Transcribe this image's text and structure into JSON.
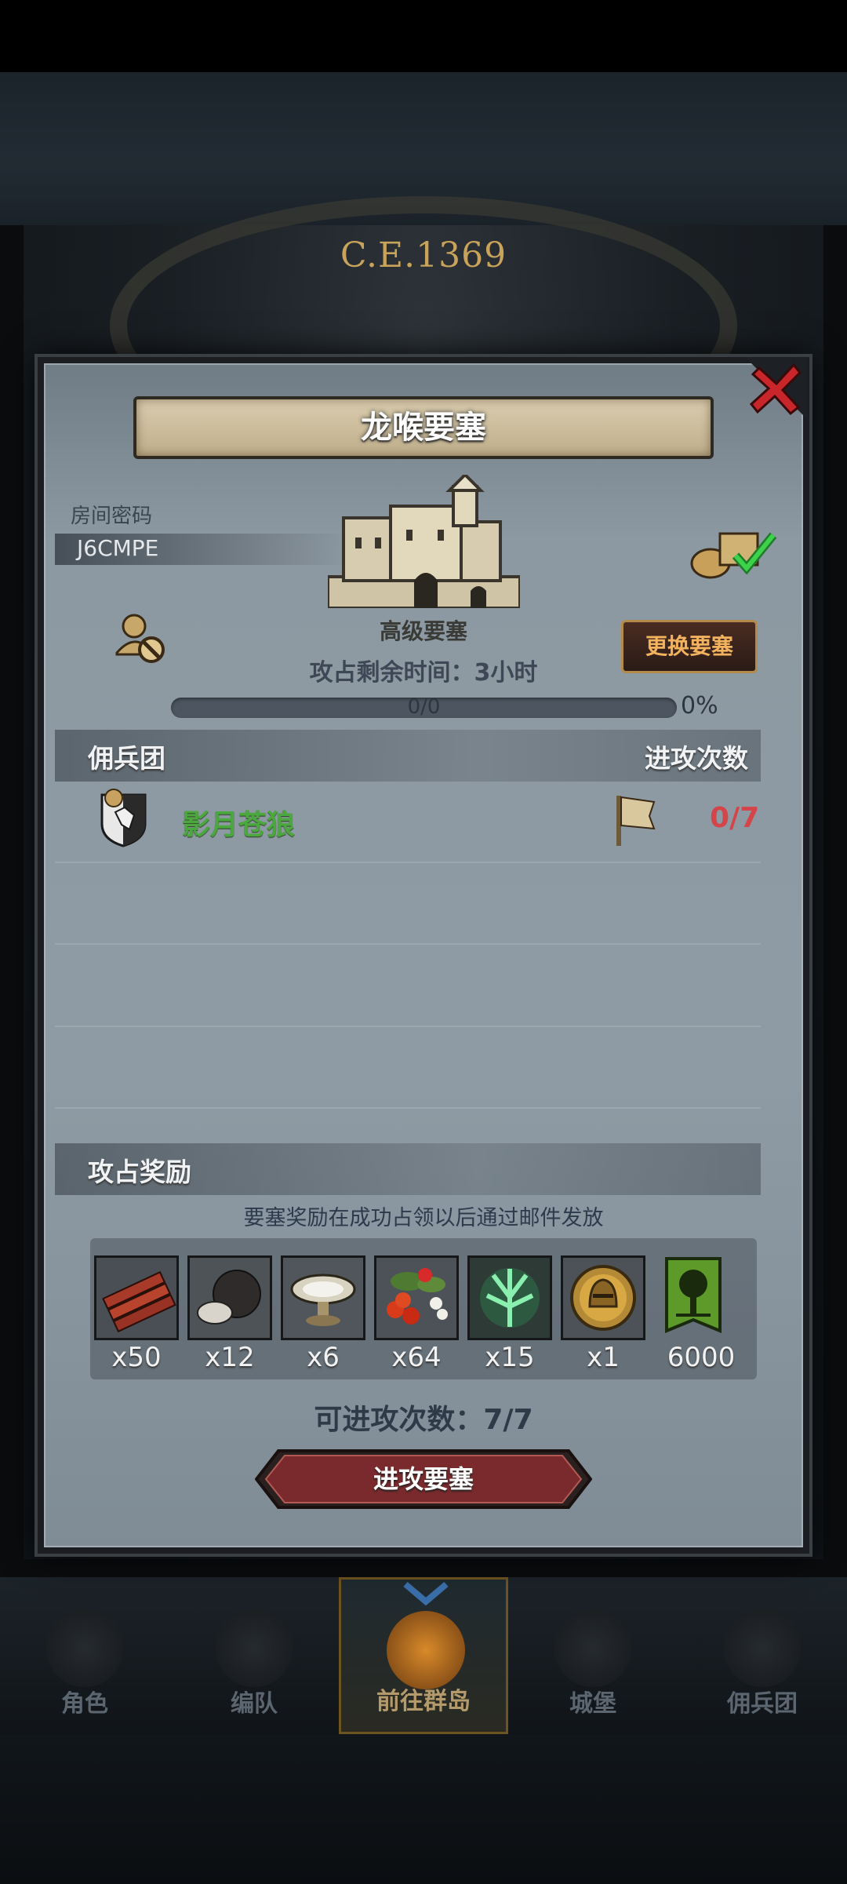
{
  "background": {
    "era_year": "C.E.1369"
  },
  "dialog": {
    "title": "龙喉要塞",
    "room_code_label": "房间密码",
    "room_code": "J6CMPE",
    "fortress_type": "高级要塞",
    "change_button": "更换要塞",
    "remaining_time": "攻占剩余时间：3小时",
    "progress": {
      "text": "0/0",
      "percent_text": "0%",
      "value": 0
    },
    "columns": {
      "mercenary": "佣兵团",
      "attacks": "进攻次数"
    },
    "mercenaries": [
      {
        "name": "影月苍狼",
        "attacks": "0/7"
      }
    ],
    "rewards_title": "攻占奖励",
    "rewards_note": "要塞奖励在成功占领以后通过邮件发放",
    "rewards": [
      {
        "icon": "wood-icon",
        "qty": "x50"
      },
      {
        "icon": "ore-icon",
        "qty": "x12"
      },
      {
        "icon": "silver-plate-icon",
        "qty": "x6"
      },
      {
        "icon": "berries-icon",
        "qty": "x64"
      },
      {
        "icon": "green-crystal-icon",
        "qty": "x15"
      },
      {
        "icon": "helmet-coin-icon",
        "qty": "x1"
      },
      {
        "icon": "guild-banner-icon",
        "qty": "6000"
      }
    ],
    "attempts": "可进攻次数：7/7",
    "attack_button": "进攻要塞"
  },
  "nav": {
    "items": [
      {
        "label": "角色",
        "icon": "character-icon"
      },
      {
        "label": "编队",
        "icon": "formation-icon"
      },
      {
        "label": "前往群岛",
        "icon": "globe-icon"
      },
      {
        "label": "城堡",
        "icon": "castle-icon"
      },
      {
        "label": "佣兵团",
        "icon": "mercenary-icon"
      }
    ]
  },
  "colors": {
    "accent_gold": "#c9a35a",
    "merc_name": "#4aa83e",
    "attack_count": "#d4454a",
    "button_red": "#7a2a2a"
  }
}
